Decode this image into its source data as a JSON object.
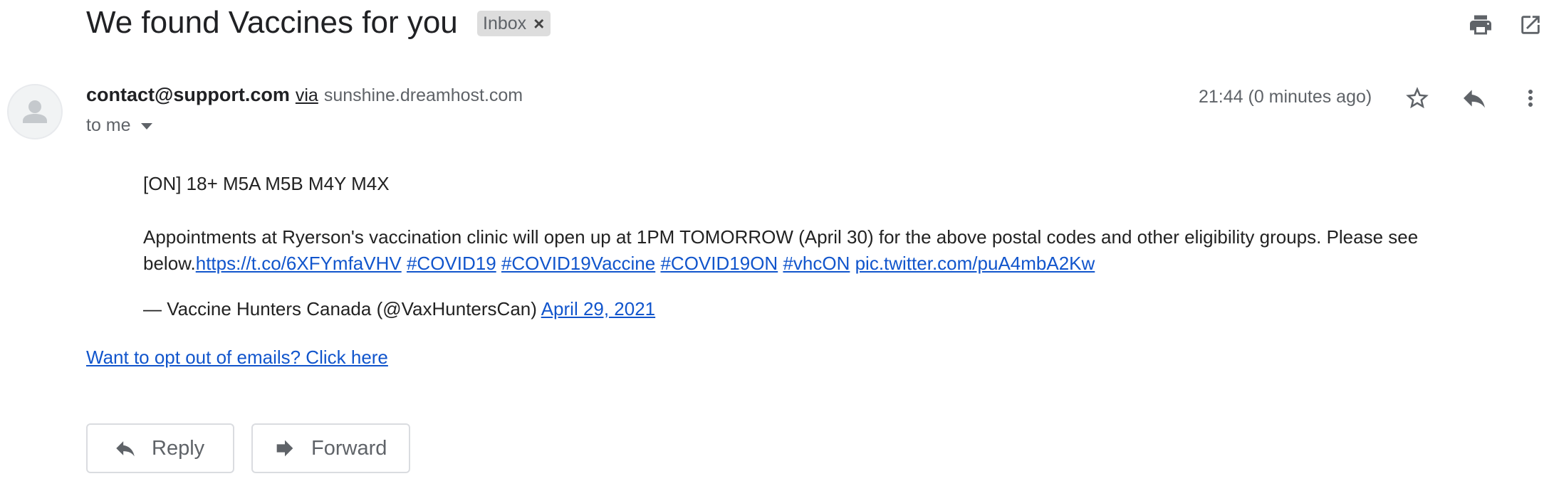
{
  "subject": "We found Vaccines for you",
  "label_chip": {
    "label": "Inbox",
    "remove": "×"
  },
  "toolbar": {
    "print_icon": "print-icon",
    "open_new_window_icon": "open-in-new-icon"
  },
  "message": {
    "sender": "contact@support.com",
    "via_label": "via",
    "via_domain": "sunshine.dreamhost.com",
    "to": "to me",
    "time": "21:44 (0 minutes ago)",
    "body": {
      "line1": "[ON] 18+ M5A M5B M4Y M4X",
      "para_text": "Appointments at Ryerson's vaccination clinic will open up at 1PM TOMORROW (April 30) for the above postal codes and other eligibility groups. Please see below.",
      "links": [
        "https://t.co/6XFYmfaVHV",
        "#COVID19",
        "#COVID19Vaccine",
        "#COVID19ON",
        "#vhcON",
        "pic.twitter.com/puA4mbA2Kw"
      ],
      "attribution": "— Vaccine Hunters Canada (@VaxHuntersCan)",
      "date_link": "April 29, 2021"
    },
    "optout_link": "Want to opt out of emails? Click here"
  },
  "actions": {
    "reply": "Reply",
    "forward": "Forward"
  },
  "colors": {
    "link": "#1155cc",
    "icon": "#5f6368",
    "chip_bg": "#dddddd"
  }
}
